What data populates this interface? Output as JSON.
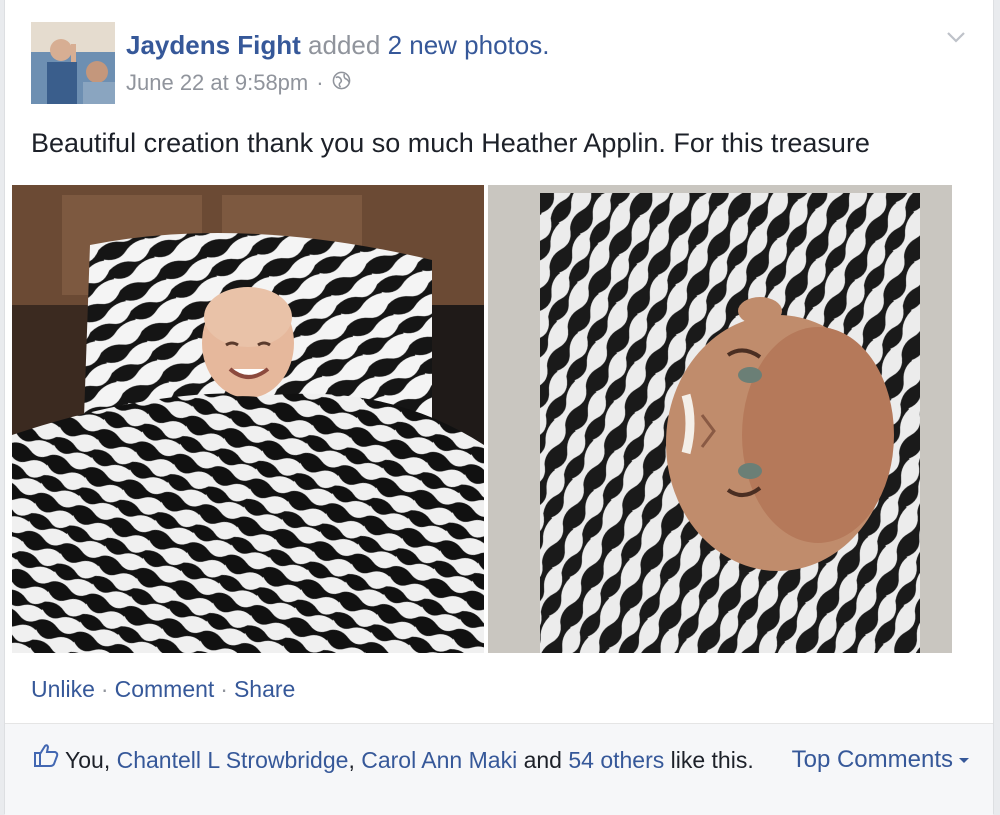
{
  "post": {
    "author": "Jaydens Fight",
    "action_text": " added ",
    "action_link": "2 new photos.",
    "timestamp": "June 22 at 9:58pm",
    "meta_sep": "·",
    "privacy_icon": "globe-icon",
    "menu_icon": "chevron-down-icon",
    "text": "Beautiful creation thank you so much Heather Applin. For this treasure",
    "photos": [
      {
        "name": "photo-child-in-zebra-blanket"
      },
      {
        "name": "photo-drawing-portrait"
      }
    ]
  },
  "actions": {
    "unlike": "Unlike",
    "comment": "Comment",
    "share": "Share",
    "separator": "·"
  },
  "likes": {
    "icon": "thumbs-up-icon",
    "you": "You, ",
    "person1": "Chantell L Strowbridge",
    "comma": ", ",
    "person2": "Carol Ann Maki",
    "and": " and ",
    "others": "54 others",
    "suffix": " like this."
  },
  "sort": {
    "label": "Top Comments",
    "icon": "caret-down-icon"
  },
  "colors": {
    "link": "#365899",
    "muted": "#90949c",
    "text": "#1d2129",
    "footer_bg": "#f6f7f9"
  }
}
